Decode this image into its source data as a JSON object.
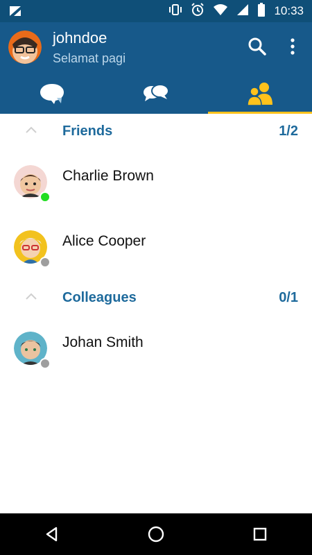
{
  "status_bar": {
    "time": "10:33",
    "icons": [
      "app-icon",
      "vibrate-icon",
      "alarm-icon",
      "wifi-icon",
      "signal-icon",
      "battery-icon"
    ]
  },
  "header": {
    "title": "johndoe",
    "subtitle": "Selamat pagi",
    "icons": [
      "search-icon",
      "more-vert-icon"
    ]
  },
  "tabs": [
    {
      "icon": "chat-bubble-icon"
    },
    {
      "icon": "group-chat-icon"
    },
    {
      "icon": "contacts-icon",
      "active": true
    }
  ],
  "groups": [
    {
      "name": "Friends",
      "count": "1/2",
      "contacts": [
        {
          "name": "Charlie Brown",
          "status": "online"
        },
        {
          "name": "Alice Cooper",
          "status": "offline"
        }
      ]
    },
    {
      "name": "Colleagues",
      "count": "0/1",
      "contacts": [
        {
          "name": "Johan Smith",
          "status": "offline"
        }
      ]
    }
  ],
  "colors": {
    "status_bar": "#0f4f78",
    "app_bar": "#17598a",
    "accent": "#ffc21c",
    "group_title": "#1e6a9c",
    "online": "#22dd22",
    "offline": "#9e9e9e"
  },
  "nav_bar": {
    "icons": [
      "back-icon",
      "home-icon",
      "recents-icon"
    ]
  }
}
